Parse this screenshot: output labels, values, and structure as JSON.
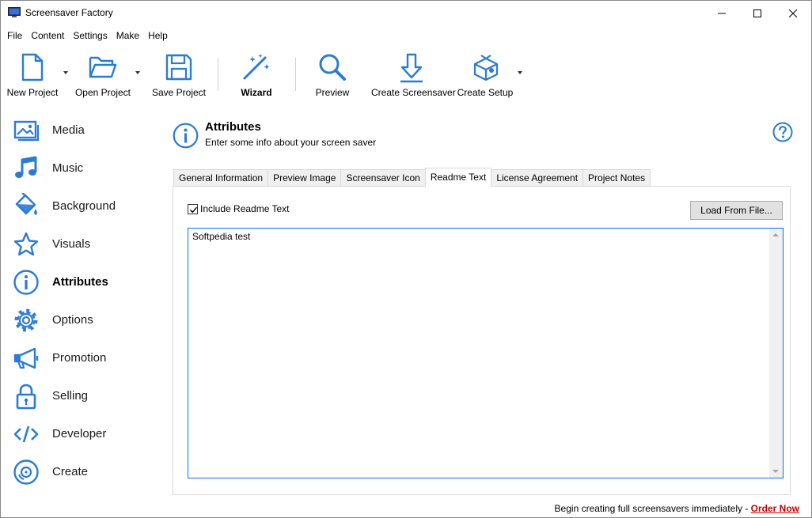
{
  "window": {
    "title": "Screensaver Factory",
    "accent_color": "#2b7bd3"
  },
  "menu": [
    "File",
    "Content",
    "Settings",
    "Make",
    "Help"
  ],
  "toolbar": {
    "new_project": "New Project",
    "open_project": "Open Project",
    "save_project": "Save Project",
    "wizard": "Wizard",
    "preview": "Preview",
    "create_screensaver": "Create Screensaver",
    "create_setup": "Create Setup"
  },
  "sidebar": {
    "items": [
      {
        "label": "Media",
        "icon": "image-icon"
      },
      {
        "label": "Music",
        "icon": "music-note-icon"
      },
      {
        "label": "Background",
        "icon": "paint-bucket-icon"
      },
      {
        "label": "Visuals",
        "icon": "star-icon"
      },
      {
        "label": "Attributes",
        "icon": "info-icon",
        "active": true
      },
      {
        "label": "Options",
        "icon": "gear-icon"
      },
      {
        "label": "Promotion",
        "icon": "megaphone-icon"
      },
      {
        "label": "Selling",
        "icon": "lock-icon"
      },
      {
        "label": "Developer",
        "icon": "code-icon"
      },
      {
        "label": "Create",
        "icon": "disc-icon"
      }
    ]
  },
  "header": {
    "title": "Attributes",
    "subtitle": "Enter some info about your screen saver"
  },
  "tabs": [
    {
      "label": "General Information"
    },
    {
      "label": "Preview Image"
    },
    {
      "label": "Screensaver Icon"
    },
    {
      "label": "Readme Text",
      "active": true
    },
    {
      "label": "License Agreement"
    },
    {
      "label": "Project Notes"
    }
  ],
  "readme": {
    "include_label": "Include Readme Text",
    "include_checked": true,
    "load_button": "Load From File...",
    "text": "Softpedia test"
  },
  "footer": {
    "text": "Begin creating full screensavers immediately - ",
    "link": "Order Now"
  }
}
